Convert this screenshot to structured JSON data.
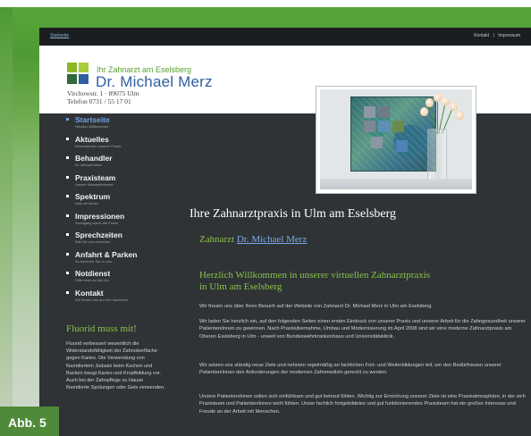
{
  "topbar": {
    "home_link": "Startseite",
    "kontakt": "Kontakt",
    "separator": "|",
    "impressum": "Impressum"
  },
  "header": {
    "tagline": "Ihr Zahnarzt am Eselsberg",
    "name_prefix": "Dr. Michael ",
    "name_surname": "Merz",
    "address_line1": "Virchowstr. 1 · 89075 Ulm",
    "address_line2": "Telefon 0731 / 55 17 01"
  },
  "nav": [
    {
      "label": "Startseite",
      "sub": "Herzlich Willkommen",
      "active": true
    },
    {
      "label": "Aktuelles",
      "sub": "Informationen unserer Praxis",
      "active": false
    },
    {
      "label": "Behandler",
      "sub": "Dr. Michael Merz",
      "active": false
    },
    {
      "label": "Praxisteam",
      "sub": "Unsere Mitarbeiterinnen",
      "active": false
    },
    {
      "label": "Spektrum",
      "sub": "Was wir bieten",
      "active": false
    },
    {
      "label": "Impressionen",
      "sub": "Rundgang durch die Praxis",
      "active": false
    },
    {
      "label": "Sprechzeiten",
      "sub": "Wie Sie uns erreichen",
      "active": false
    },
    {
      "label": "Anfahrt & Parken",
      "sub": "So kommen Sie zu uns",
      "active": false
    },
    {
      "label": "Notdienst",
      "sub": "Hilfe rund um die Uhr",
      "active": false
    },
    {
      "label": "Kontakt",
      "sub": "Wir freuen uns auf Ihre Nachricht",
      "active": false
    }
  ],
  "sidebar_box": {
    "title": "Fluorid muss mit!",
    "text": "Fluorid verbessert wesentlich die Widerstandsfähigkeit der Zahnoberfläche gegen Karies. Die Verwendung von fluoridiertem Jodsalz beim Kochen und Backen beugt Karies und Kropfbildung vor. Auch bei der Zahnpflege zu Hause fluoridierte Spülungen oder Gels verwenden."
  },
  "main": {
    "title": "Ihre Zahnarztpraxis in Ulm am Eselsberg",
    "arzt_prefix": "Zahnarzt ",
    "arzt_link": "Dr. Michael Merz",
    "welcome_line1": "Herzlich Willkommen in unserer virtuellen Zahnarztpraxis",
    "welcome_line2": "in Ulm am Eselsberg",
    "paragraphs": [
      "Wir freuen uns über Ihren Besuch auf der Website von Zahnarzt Dr. Michael Merz in Ulm am Eselsberg.",
      "Wir laden Sie herzlich ein, auf den folgenden Seiten einen ersten Eindruck von unserer Praxis und unserer Arbeit für die Zahngesundheit unserer Patienten/innen zu gewinnen. Nach Praxisübernahme, Umbau und Modernisierung im April 2008 sind wir eine moderne Zahnarztpraxis am Oberen Eselsberg in Ulm - unweit von Bundeswehrkrankenhaus und Universitätsklinik.",
      "Wir setzen uns ständig neue Ziele und nehmen regelmäßig an fachlichen Fort- und Weiterbildungen teil, um den Bedürfnissen unserer Patienten/innen den Anforderungen der modernen Zahnmedizin gerecht zu werden.",
      "Unsere Patienten/innen sollen sich einfühlsam und gut betreut fühlen. Wichtig zur Erreichung unserer Ziele ist eine Praxisatmosphäre, in der sich Praxisteam und Patienten/innen wohl fühlen. Unser fachlich fortgebildetes und gut funktionierendes Praxisteam hat ein großes Interesse und Freude an der Arbeit mit Menschen."
    ]
  },
  "figure_label": "Abb. 5",
  "colors": {
    "accent_green": "#8ac14a",
    "link_blue": "#7aa8e8",
    "site_bg": "#2f3335",
    "logo_blue": "#2f5ea3"
  }
}
